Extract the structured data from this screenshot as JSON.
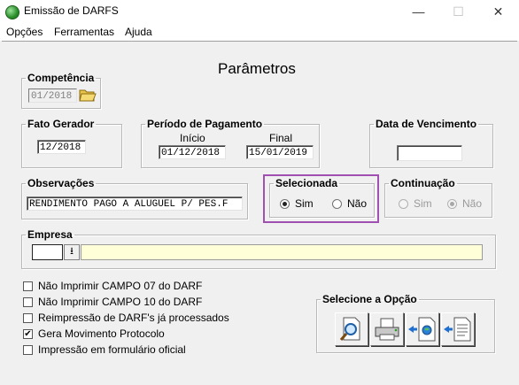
{
  "window": {
    "title": "Emissão de DARFS",
    "minimize": "—",
    "maximize": "☐",
    "close": "✕"
  },
  "menu": [
    "Opções",
    "Ferramentas",
    "Ajuda"
  ],
  "heading": "Parâmetros",
  "competencia": {
    "label": "Competência",
    "value": "01/2018"
  },
  "fato_gerador": {
    "label": "Fato Gerador",
    "value": "12/2018"
  },
  "periodo": {
    "label": "Período de Pagamento",
    "inicio_label": "Início",
    "inicio": "01/12/2018",
    "final_label": "Final",
    "final": "15/01/2019"
  },
  "vencimento": {
    "label": "Data de Vencimento",
    "value": ""
  },
  "observacoes": {
    "label": "Observações",
    "value": "RENDIMENTO PAGO A ALUGUEL P/ PES.F"
  },
  "selecionada": {
    "label": "Selecionada",
    "sim": "Sim",
    "nao": "Não",
    "selected": "Sim",
    "highlight_color": "#a050b0"
  },
  "continuacao": {
    "label": "Continuação",
    "sim": "Sim",
    "nao": "Não",
    "selected": "Não",
    "enabled": false
  },
  "empresa": {
    "label": "Empresa",
    "code": "",
    "name": "",
    "name_bg": "#ffffd8"
  },
  "options": [
    {
      "label": "Não Imprimir CAMPO 07 do DARF",
      "checked": false
    },
    {
      "label": "Não Imprimir CAMPO 10 do DARF",
      "checked": false
    },
    {
      "label": "Reimpressão de DARF's já processados",
      "checked": false
    },
    {
      "label": "Gera Movimento Protocolo",
      "checked": true
    },
    {
      "label": "Impressão em formulário oficial",
      "checked": false
    }
  ],
  "selecione": {
    "label": "Selecione a Opção",
    "buttons": [
      "preview-icon",
      "printer-icon",
      "export-document-icon",
      "export-list-icon"
    ]
  }
}
